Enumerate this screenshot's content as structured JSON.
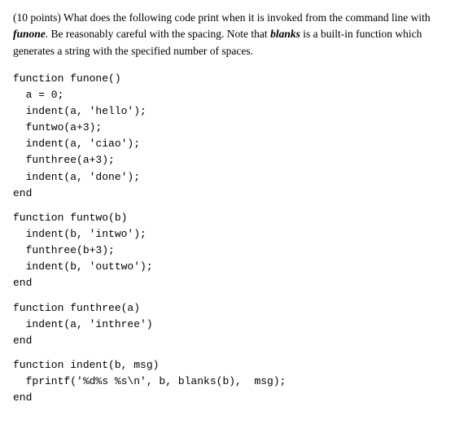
{
  "intro": {
    "text_parts": [
      "(10 points) What does the following code print when it is invoked from the command line with ",
      "funone",
      ". Be reasonably careful with the spacing. Note that ",
      "blanks",
      " is a built-in function which generates a string with the specified number of spaces."
    ]
  },
  "functions": [
    {
      "id": "funone",
      "code": "function funone()\n  a = 0;\n  indent(a, 'hello');\n  funtwo(a+3);\n  indent(a, 'ciao');\n  funthree(a+3);\n  indent(a, 'done');\nend"
    },
    {
      "id": "funtwo",
      "code": "function funtwo(b)\n  indent(b, 'intwo');\n  funthree(b+3);\n  indent(b, 'outtwo');\nend"
    },
    {
      "id": "funthree",
      "code": "function funthree(a)\n  indent(a, 'inthree')\nend"
    },
    {
      "id": "indent",
      "code": "function indent(b, msg)\n  fprintf('%d%s %s\\n', b, blanks(b),  msg);\nend"
    }
  ]
}
